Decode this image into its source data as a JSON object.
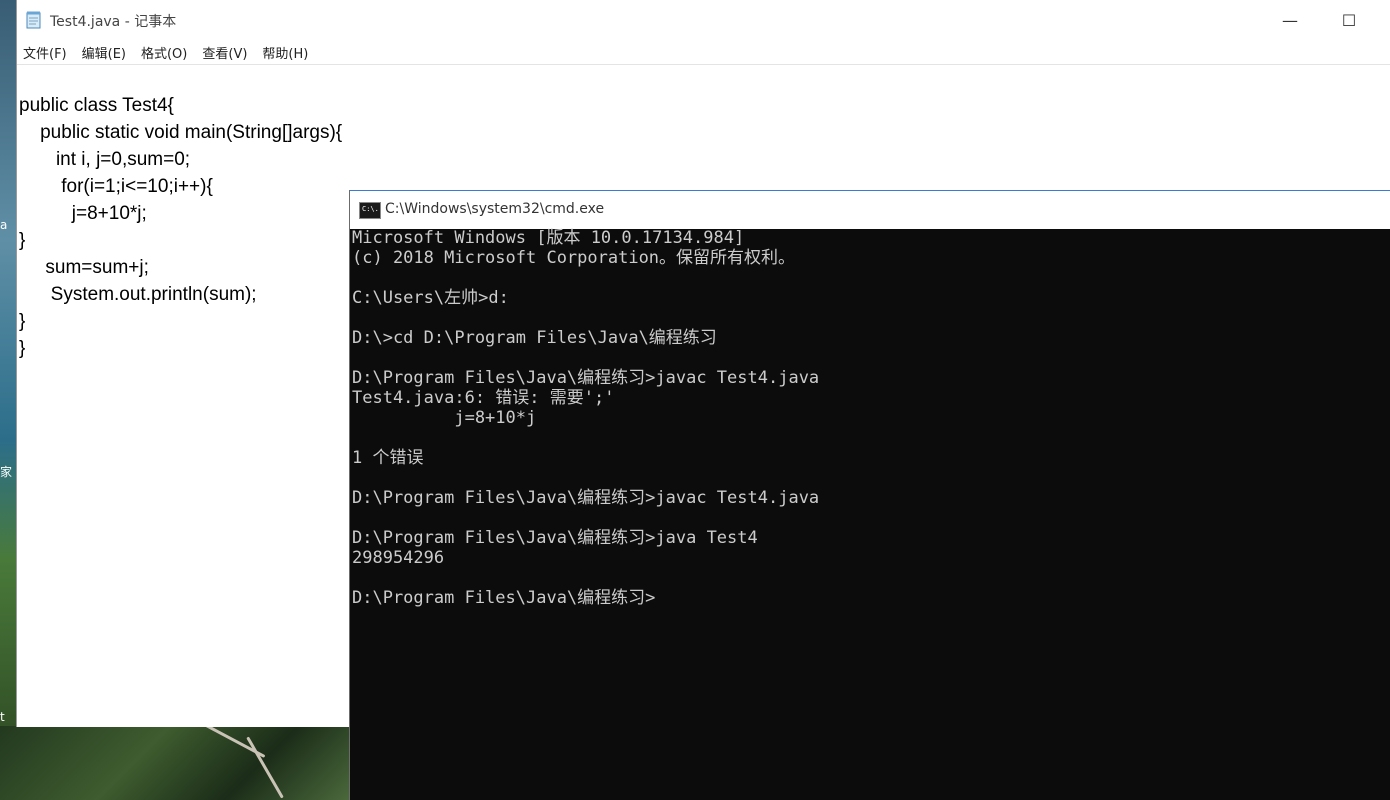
{
  "desktop": {
    "labels": [
      "a",
      "家",
      "t"
    ]
  },
  "notepad": {
    "title": "Test4.java - 记事本",
    "menu": [
      "文件(F)",
      "编辑(E)",
      "格式(O)",
      "查看(V)",
      "帮助(H)"
    ],
    "minimize_glyph": "—",
    "maximize_glyph": "☐",
    "code_lines": [
      "public class Test4{",
      "    public static void main(String[]args){",
      "       int i, j=0,sum=0;",
      "        for(i=1;i<=10;i++){",
      "          j=8+10*j;",
      "}",
      "     sum=sum+j;",
      "      System.out.println(sum);",
      "}",
      "}"
    ]
  },
  "cmd": {
    "title": "C:\\Windows\\system32\\cmd.exe",
    "icon_text": "C:\\.",
    "lines": [
      "Microsoft Windows [版本 10.0.17134.984]",
      "(c) 2018 Microsoft Corporation。保留所有权利。",
      "",
      "C:\\Users\\左帅>d:",
      "",
      "D:\\>cd D:\\Program Files\\Java\\编程练习",
      "",
      "D:\\Program Files\\Java\\编程练习>javac Test4.java",
      "Test4.java:6: 错误: 需要';'",
      "          j=8+10*j",
      "",
      "1 个错误",
      "",
      "D:\\Program Files\\Java\\编程练习>javac Test4.java",
      "",
      "D:\\Program Files\\Java\\编程练习>java Test4",
      "298954296",
      "",
      "D:\\Program Files\\Java\\编程练习>"
    ]
  }
}
